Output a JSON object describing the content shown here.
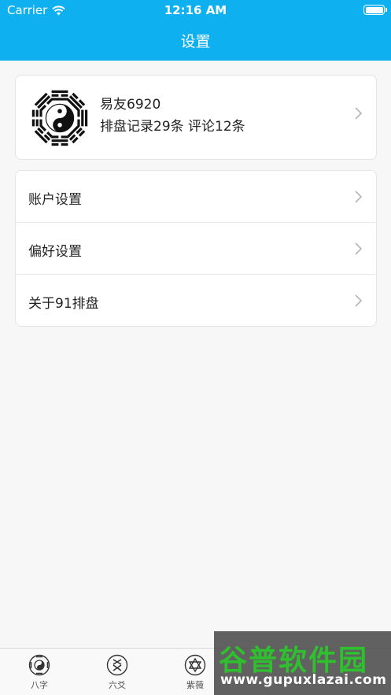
{
  "status_bar": {
    "carrier": "Carrier",
    "time": "12:16 AM"
  },
  "nav": {
    "title": "设置"
  },
  "profile": {
    "name": "易友6920",
    "stats": "排盘记录29条 评论12条",
    "avatar_icon": "bagua-icon"
  },
  "menu": {
    "items": [
      {
        "label": "账户设置"
      },
      {
        "label": "偏好设置"
      },
      {
        "label": "关于91排盘"
      }
    ]
  },
  "tabs": [
    {
      "label": "八字",
      "icon": "bazi-icon"
    },
    {
      "label": "六爻",
      "icon": "liuyao-icon"
    },
    {
      "label": "紫薇",
      "icon": "ziwei-icon"
    }
  ],
  "watermark": {
    "title": "谷普软件园",
    "url": "www.gupuxlazai.com"
  },
  "colors": {
    "header_bg": "#0fb0ef",
    "page_bg": "#f7f7f7",
    "watermark_green": "#2fbf2f"
  }
}
